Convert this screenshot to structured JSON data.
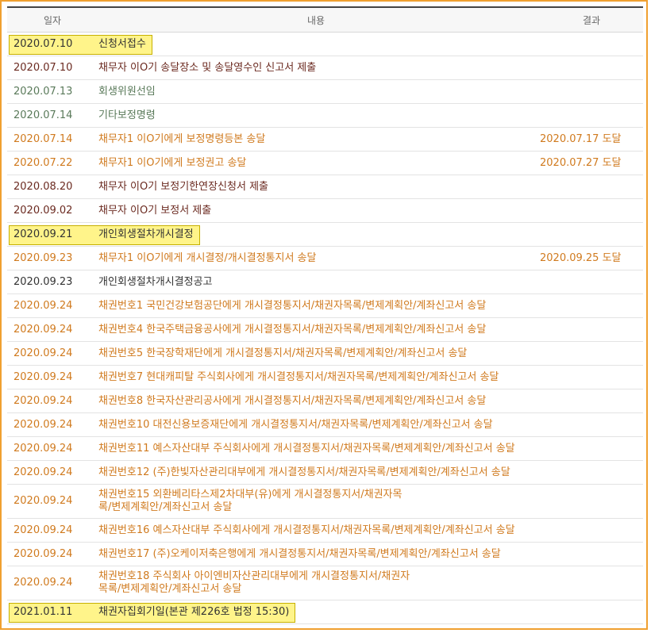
{
  "headers": {
    "date": "일자",
    "content": "내용",
    "result": "결과"
  },
  "rows": [
    {
      "date": "2020.07.10",
      "content": "신청서접수",
      "result": "",
      "color": "black",
      "highlight": true
    },
    {
      "date": "2020.07.10",
      "content": "채무자 이O기 송달장소 및 송달영수인 신고서 제출",
      "result": "",
      "color": "darkred",
      "highlight": false
    },
    {
      "date": "2020.07.13",
      "content": "회생위원선임",
      "result": "",
      "color": "green",
      "highlight": false
    },
    {
      "date": "2020.07.14",
      "content": "기타보정명령",
      "result": "",
      "color": "green",
      "highlight": false
    },
    {
      "date": "2020.07.14",
      "content": "채무자1 이O기에게 보정명령등본 송달",
      "result": "2020.07.17 도달",
      "color": "orange",
      "highlight": false
    },
    {
      "date": "2020.07.22",
      "content": "채무자1 이O기에게 보정권고 송달",
      "result": "2020.07.27 도달",
      "color": "orange",
      "highlight": false
    },
    {
      "date": "2020.08.20",
      "content": "채무자 이O기 보정기한연장신청서 제출",
      "result": "",
      "color": "darkred",
      "highlight": false
    },
    {
      "date": "2020.09.02",
      "content": "채무자 이O기 보정서 제출",
      "result": "",
      "color": "darkred",
      "highlight": false
    },
    {
      "date": "2020.09.21",
      "content": "개인회생절차개시결정",
      "result": "",
      "color": "black",
      "highlight": true
    },
    {
      "date": "2020.09.23",
      "content": "채무자1 이O기에게 개시결정/개시결정통지서 송달",
      "result": "2020.09.25 도달",
      "color": "orange",
      "highlight": false
    },
    {
      "date": "2020.09.23",
      "content": "개인회생절차개시결정공고",
      "result": "",
      "color": "black",
      "highlight": false
    },
    {
      "date": "2020.09.24",
      "content": "채권번호1 국민건강보험공단에게 개시결정통지서/채권자목록/변제계획안/계좌신고서 송달",
      "result": "",
      "color": "orange",
      "highlight": false
    },
    {
      "date": "2020.09.24",
      "content": "채권번호4 한국주택금융공사에게 개시결정통지서/채권자목록/변제계획안/계좌신고서 송달",
      "result": "",
      "color": "orange",
      "highlight": false
    },
    {
      "date": "2020.09.24",
      "content": "채권번호5 한국장학재단에게 개시결정통지서/채권자목록/변제계획안/계좌신고서 송달",
      "result": "",
      "color": "orange",
      "highlight": false
    },
    {
      "date": "2020.09.24",
      "content": "채권번호7 현대캐피탈 주식회사에게 개시결정통지서/채권자목록/변제계획안/계좌신고서 송달",
      "result": "",
      "color": "orange",
      "highlight": false
    },
    {
      "date": "2020.09.24",
      "content": "채권번호8 한국자산관리공사에게 개시결정통지서/채권자목록/변제계획안/계좌신고서 송달",
      "result": "",
      "color": "orange",
      "highlight": false
    },
    {
      "date": "2020.09.24",
      "content": "채권번호10 대전신용보증재단에게 개시결정통지서/채권자목록/변제계획안/계좌신고서 송달",
      "result": "",
      "color": "orange",
      "highlight": false
    },
    {
      "date": "2020.09.24",
      "content": "채권번호11 예스자산대부 주식회사에게 개시결정통지서/채권자목록/변제계획안/계좌신고서 송달",
      "result": "",
      "color": "orange",
      "highlight": false
    },
    {
      "date": "2020.09.24",
      "content": "채권번호12 (주)한빛자산관리대부에게 개시결정통지서/채권자목록/변제계획안/계좌신고서 송달",
      "result": "",
      "color": "orange",
      "highlight": false
    },
    {
      "date": "2020.09.24",
      "content": "채권번호15 외환베리타스제2차대부(유)에게 개시결정통지서/채권자목록/변제계획안/계좌신고서 송달",
      "result": "",
      "color": "orange",
      "highlight": false,
      "tall": true
    },
    {
      "date": "2020.09.24",
      "content": "채권번호16 예스자산대부 주식회사에게 개시결정통지서/채권자목록/변제계획안/계좌신고서 송달",
      "result": "",
      "color": "orange",
      "highlight": false
    },
    {
      "date": "2020.09.24",
      "content": "채권번호17 (주)오케이저축은행에게 개시결정통지서/채권자목록/변제계획안/계좌신고서 송달",
      "result": "",
      "color": "orange",
      "highlight": false
    },
    {
      "date": "2020.09.24",
      "content": "채권번호18 주식회사 아이엔비자산관리대부에게 개시결정통지서/채권자목록/변제계획안/계좌신고서 송달",
      "result": "",
      "color": "orange",
      "highlight": false,
      "tall": true
    },
    {
      "date": "2021.01.11",
      "content": "채권자집회기일(본관 제226호 법정 15:30)",
      "result": "",
      "color": "black",
      "highlight": true
    }
  ]
}
